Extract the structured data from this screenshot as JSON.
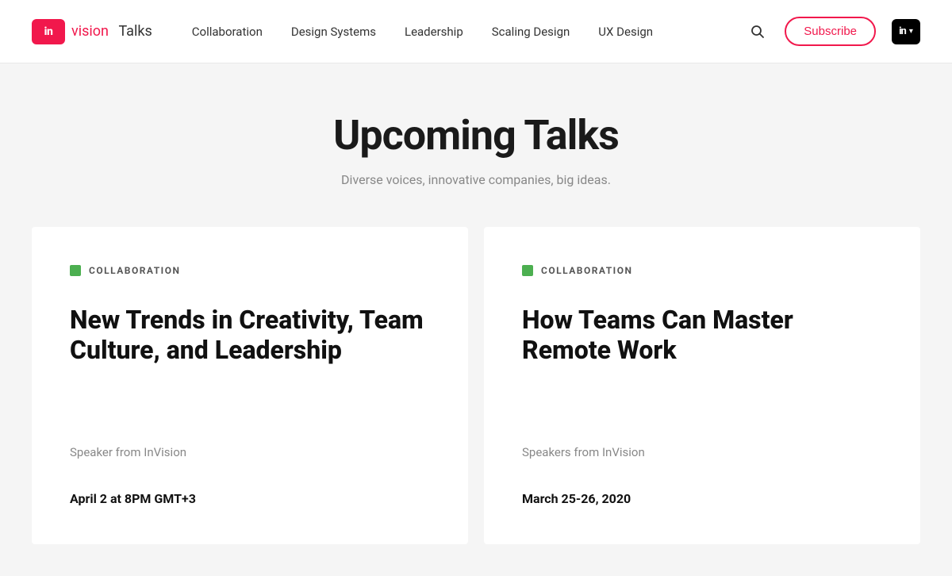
{
  "logo": {
    "in_text": "in",
    "brand_red": "vision",
    "brand_dark": "",
    "talks_label": "Talks"
  },
  "nav": {
    "items": [
      {
        "label": "Collaboration",
        "id": "nav-collaboration"
      },
      {
        "label": "Design Systems",
        "id": "nav-design-systems"
      },
      {
        "label": "Leadership",
        "id": "nav-leadership"
      },
      {
        "label": "Scaling Design",
        "id": "nav-scaling-design"
      },
      {
        "label": "UX Design",
        "id": "nav-ux-design"
      }
    ]
  },
  "header": {
    "subscribe_label": "Subscribe",
    "in_menu_label": "in"
  },
  "hero": {
    "title": "Upcoming Talks",
    "subtitle": "Diverse voices, innovative companies, big ideas."
  },
  "cards": [
    {
      "category": "COLLABORATION",
      "title": "New Trends in Creativity, Team Culture, and Leadership",
      "speaker": "Speaker from InVision",
      "date": "April 2 at 8PM GMT+3"
    },
    {
      "category": "COLLABORATION",
      "title": "How Teams Can Master Remote Work",
      "speaker": "Speakers from InVision",
      "date": "March 25-26, 2020"
    }
  ],
  "icons": {
    "search": "🔍",
    "chevron_down": "▾"
  },
  "colors": {
    "brand_red": "#f1184c",
    "category_green": "#4caf50",
    "dark": "#111111",
    "gray": "#888888"
  }
}
